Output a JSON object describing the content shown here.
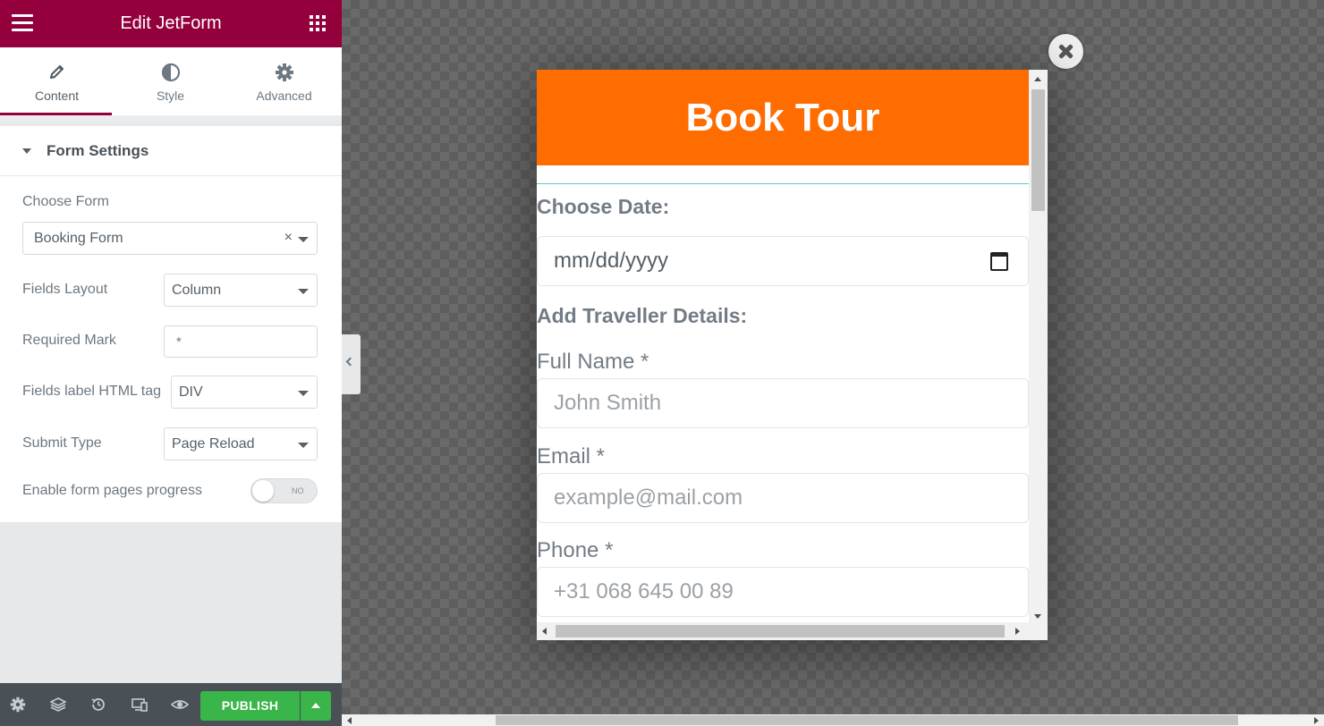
{
  "panel": {
    "title": "Edit JetForm",
    "accent_color": "#93003c",
    "tabs": [
      {
        "label": "Content",
        "icon": "pencil-icon",
        "active": true
      },
      {
        "label": "Style",
        "icon": "half-circle-icon",
        "active": false
      },
      {
        "label": "Advanced",
        "icon": "gear-icon",
        "active": false
      }
    ],
    "section_title": "Form Settings",
    "controls": {
      "choose_form": {
        "label": "Choose Form",
        "value": "Booking Form",
        "clear": "×"
      },
      "fields_layout": {
        "label": "Fields Layout",
        "value": "Column"
      },
      "required_mark": {
        "label": "Required Mark",
        "value": "*"
      },
      "fields_label_tag": {
        "label": "Fields label HTML tag",
        "value": "DIV"
      },
      "submit_type": {
        "label": "Submit Type",
        "value": "Page Reload"
      },
      "pages_progress": {
        "label": "Enable form pages progress",
        "toggle_text": "NO",
        "enabled": false
      }
    },
    "footer": {
      "icons": [
        "settings-icon",
        "layers-icon",
        "history-icon",
        "responsive-icon",
        "preview-eye-icon"
      ],
      "publish_label": "PUBLISH",
      "publish_color": "#39b54a"
    }
  },
  "modal": {
    "banner_title": "Book Tour",
    "banner_color": "#ff6c00",
    "choose_date_heading": "Choose Date:",
    "date_placeholder": "mm/dd/yyyy",
    "traveller_heading": "Add Traveller Details:",
    "fields": [
      {
        "label": "Full Name *",
        "placeholder": "John Smith"
      },
      {
        "label": "Email *",
        "placeholder": "example@mail.com"
      },
      {
        "label": "Phone *",
        "placeholder": "+31 068 645 00 89"
      }
    ]
  }
}
